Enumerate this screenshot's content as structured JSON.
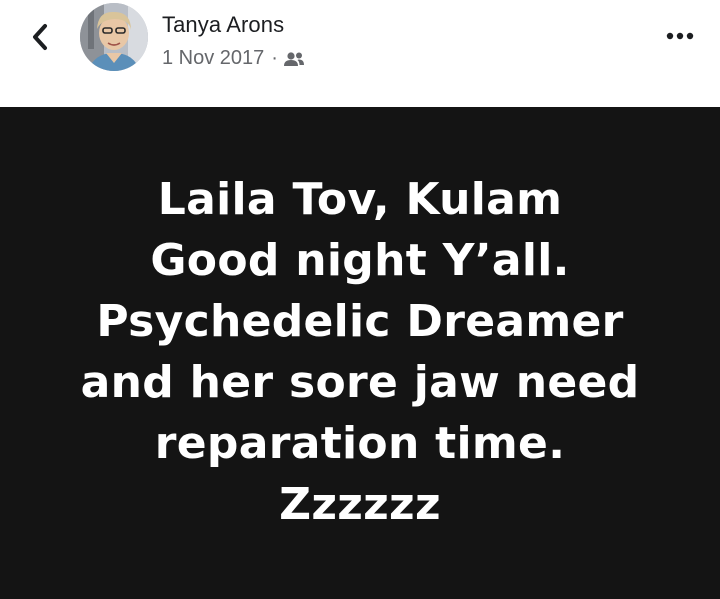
{
  "header": {
    "back_icon": "chevron-left-icon",
    "author_name": "Tanya Arons",
    "post_date": "1 Nov 2017",
    "separator": "·",
    "audience_icon": "friends-icon",
    "more_icon": "more-horizontal-icon"
  },
  "post": {
    "background_color": "#141414",
    "text_color": "#ffffff",
    "lines": [
      "Laila Tov, Kulam",
      "Good night Y’all.",
      "Psychedelic Dreamer",
      "and her sore jaw need",
      "reparation time.",
      "Zzzzzz"
    ]
  }
}
